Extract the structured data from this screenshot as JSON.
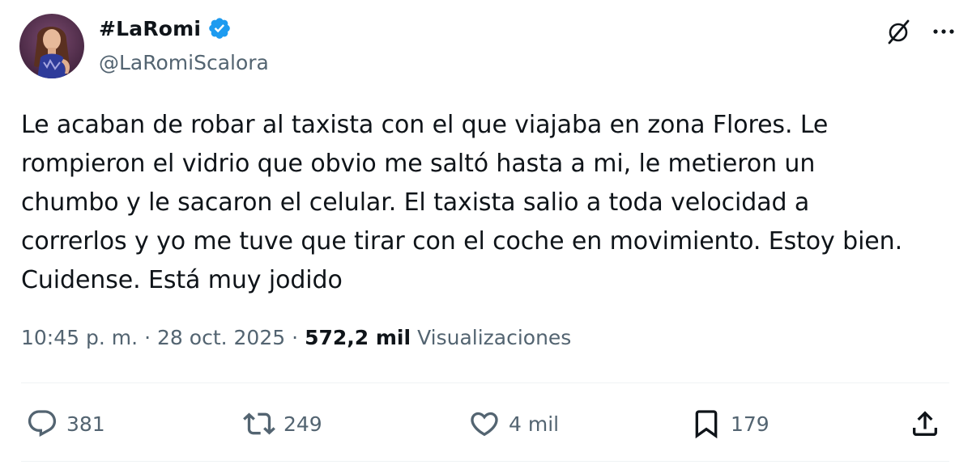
{
  "author": {
    "display_name": "#LaRomi",
    "handle": "@LaRomiScalora",
    "verified": true,
    "verified_color": "#1d9bf0",
    "avatar_icon": "profile-photo"
  },
  "header_actions": {
    "grok_icon": "grok-icon",
    "more_icon": "more-horizontal-icon"
  },
  "tweet": {
    "text": "Le acaban de robar al taxista con el que viajaba en zona Flores. Le\nrompieron el vidrio que obvio me saltó hasta a mi, le metieron un\nchumbo y le sacaron el celular. El taxista salio a toda velocidad a\ncorrerlos y yo me tuve que tirar con el coche en movimiento. Estoy bien.\nCuidense. Está muy jodido"
  },
  "meta": {
    "time": "10:45 p. m.",
    "separator": "·",
    "date": "28 oct. 2025",
    "views_count": "572,2 mil",
    "views_label": "Visualizaciones"
  },
  "actions": {
    "replies": "381",
    "retweets": "249",
    "likes": "4 mil",
    "bookmarks": "179"
  },
  "colors": {
    "text": "#0f1419",
    "secondary": "#536471",
    "divider": "#eff3f4"
  }
}
